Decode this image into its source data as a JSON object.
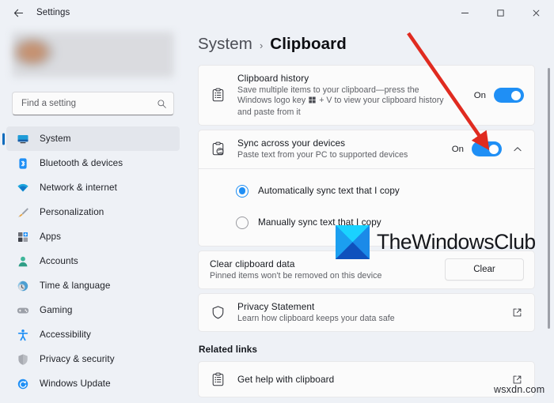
{
  "window": {
    "app_title": "Settings",
    "back_icon": "back-arrow-icon",
    "minimize_label": "–",
    "maximize_label": "□",
    "close_label": "✕"
  },
  "sidebar": {
    "search": {
      "placeholder": "Find a setting",
      "value": "",
      "icon": "search-icon"
    },
    "items": [
      {
        "label": "System",
        "icon": "monitor-icon",
        "selected": true
      },
      {
        "label": "Bluetooth & devices",
        "icon": "bluetooth-icon",
        "selected": false
      },
      {
        "label": "Network & internet",
        "icon": "wifi-icon",
        "selected": false
      },
      {
        "label": "Personalization",
        "icon": "paintbrush-icon",
        "selected": false
      },
      {
        "label": "Apps",
        "icon": "apps-grid-icon",
        "selected": false
      },
      {
        "label": "Accounts",
        "icon": "person-icon",
        "selected": false
      },
      {
        "label": "Time & language",
        "icon": "clock-globe-icon",
        "selected": false
      },
      {
        "label": "Gaming",
        "icon": "gamepad-icon",
        "selected": false
      },
      {
        "label": "Accessibility",
        "icon": "accessibility-person-icon",
        "selected": false
      },
      {
        "label": "Privacy & security",
        "icon": "shield-icon",
        "selected": false
      },
      {
        "label": "Windows Update",
        "icon": "update-refresh-icon",
        "selected": false
      }
    ]
  },
  "main": {
    "breadcrumb": {
      "parent": "System",
      "separator": "›",
      "current": "Clipboard"
    },
    "clipboard_history": {
      "title": "Clipboard history",
      "description_line1": "Save multiple items to your clipboard—press the",
      "description_line2a": "Windows logo key",
      "description_line2b": "+ V to view your clipboard history",
      "description_line3": "and paste from it",
      "icon": "clipboard-list-icon",
      "toggle_state": "On"
    },
    "sync_devices": {
      "title": "Sync across your devices",
      "description": "Paste text from your PC to supported devices",
      "icon": "clipboard-sync-icon",
      "toggle_state": "On",
      "expand_icon": "chevron-up-icon",
      "options": [
        {
          "label": "Automatically sync text that I copy",
          "checked": true
        },
        {
          "label": "Manually sync text that I copy",
          "checked": false
        }
      ]
    },
    "clear_clipboard": {
      "title": "Clear clipboard data",
      "description": "Pinned items won't be removed on this device",
      "button_label": "Clear"
    },
    "privacy_statement": {
      "title": "Privacy Statement",
      "description": "Learn how clipboard keeps your data safe",
      "icon": "shield-outline-icon",
      "external_icon": "external-link-icon"
    },
    "related_links": {
      "heading": "Related links",
      "items": [
        {
          "label": "Get help with clipboard",
          "icon": "clipboard-list-icon",
          "external_icon": "external-link-icon"
        }
      ]
    }
  },
  "annotations": {
    "arrow": {
      "color": "#e02b20",
      "target": "sync-devices-toggle"
    },
    "watermark_text": "TheWindowsClub",
    "site_watermark": "wsxdn.com"
  },
  "colors": {
    "accent": "#1f8ff5",
    "selected_bar": "#0f6cbd",
    "sidebar_bg": "#eef1f6",
    "card_bg": "#fbfbfb"
  }
}
